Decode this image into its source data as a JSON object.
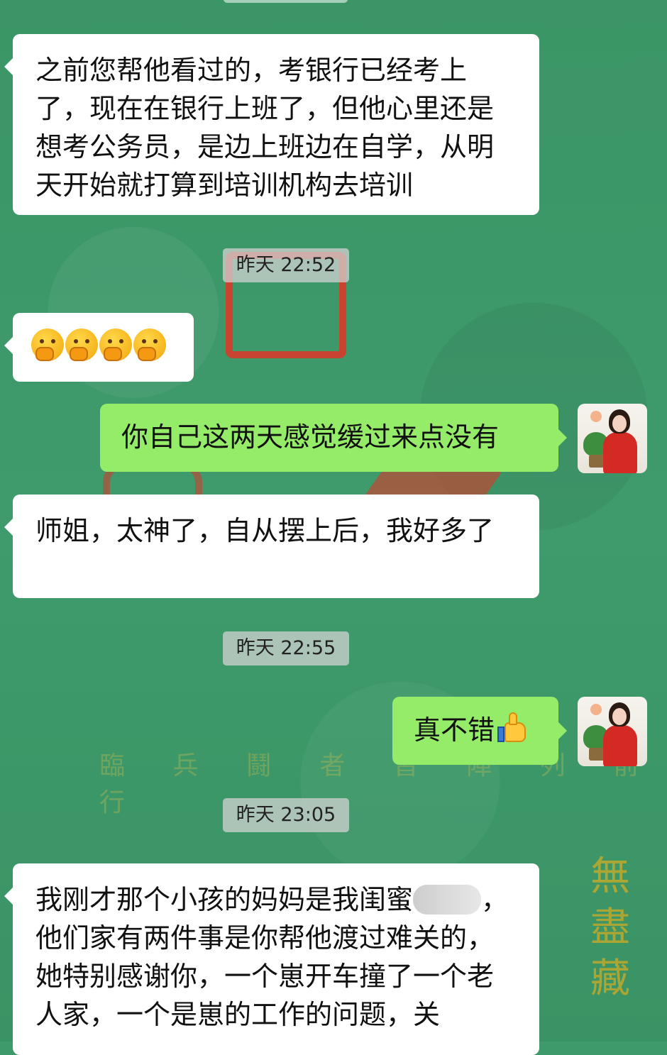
{
  "messages": [
    {
      "type": "in",
      "text": "之前您帮他看过的，考银行已经考上了，现在在银行上班了，但他心里还是想考公务员，是边上班边在自学，从明天开始就打算到培训机构去培训"
    },
    {
      "type": "time",
      "text": "昨天 22:52"
    },
    {
      "type": "in_emoji",
      "emoji": [
        "face-with-hand-over-mouth-icon",
        "face-with-hand-over-mouth-icon",
        "face-with-hand-over-mouth-icon",
        "face-with-hand-over-mouth-icon"
      ]
    },
    {
      "type": "out",
      "text": "你自己这两天感觉缓过来点没有"
    },
    {
      "type": "in",
      "text": "师姐，太神了，自从摆上后，我好多了"
    },
    {
      "type": "time",
      "text": "昨天 22:55"
    },
    {
      "type": "out",
      "text": "真不错",
      "emoji": "thumbs-up-icon"
    },
    {
      "type": "time",
      "text": "昨天 23:05"
    },
    {
      "type": "in",
      "text_before_blur": "我刚才那个小孩的妈妈是我闺蜜",
      "text_after_blur": "，他们家有两件事是你帮他渡过难关的，她特别感谢你，一个崽开车撞了一个老人家，一个是崽的工作的问题，关"
    }
  ],
  "background": {
    "caption": "臨 兵 鬪 者 皆 陣 列 前 行",
    "vertical_text": "無盡藏"
  },
  "colors": {
    "chat_bg": "#3f9a6b",
    "incoming_bubble": "#ffffff",
    "outgoing_bubble": "#95ec69",
    "time_badge": "#d2d2d2"
  }
}
